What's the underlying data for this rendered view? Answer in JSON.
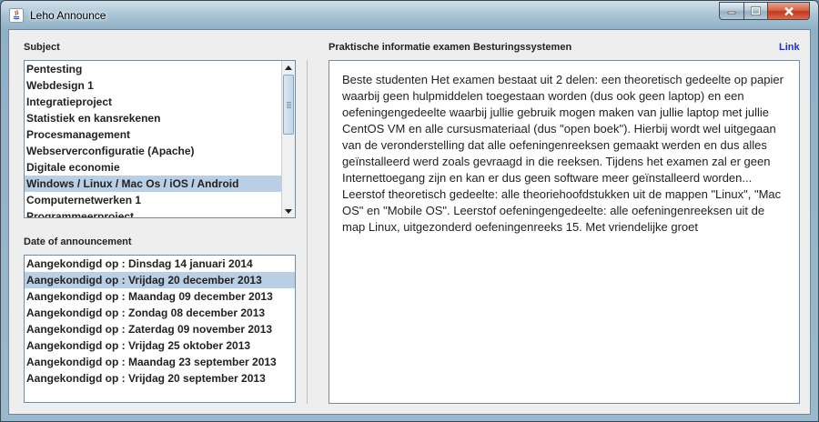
{
  "window": {
    "title": "Leho Announce",
    "controls": {
      "minimize": "minimize-icon",
      "maximize": "maximize-icon",
      "close": "close-icon"
    }
  },
  "subject": {
    "label": "Subject",
    "items": [
      "Pentesting",
      "Webdesign 1",
      "Integratieproject",
      "Statistiek en kansrekenen",
      "Procesmanagement",
      "Webserverconfiguratie (Apache)",
      "Digitale economie",
      "Windows / Linux / Mac Os / iOS / Android",
      "Computernetwerken 1",
      "Programmeerproject"
    ],
    "selected_index": 7
  },
  "announcements": {
    "label": "Date of announcement",
    "items": [
      "Aangekondigd op : Dinsdag 14 januari 2014",
      "Aangekondigd op : Vrijdag 20 december 2013",
      "Aangekondigd op : Maandag 09 december 2013",
      "Aangekondigd op : Zondag 08 december 2013",
      "Aangekondigd op : Zaterdag 09 november 2013",
      "Aangekondigd op : Vrijdag 25 oktober 2013",
      "Aangekondigd op : Maandag 23 september 2013",
      "Aangekondigd op : Vrijdag 20 september 2013"
    ],
    "selected_index": 1
  },
  "detail": {
    "title": "Praktische informatie examen Besturingssystemen",
    "link_label": "Link",
    "body": "Beste studenten Het examen bestaat uit 2 delen: een theoretisch gedeelte op papier waarbij geen hulpmiddelen toegestaan worden (dus ook geen laptop) en een oefeningengedeelte waarbij jullie gebruik mogen maken van jullie laptop met jullie CentOS VM en alle cursusmateriaal (dus \"open boek\"). Hierbij wordt wel uitgegaan van de veronderstelling dat alle oefeningenreeksen gemaakt werden en dus alles geïnstalleerd werd zoals gevraagd in die reeksen. Tijdens het examen zal er geen Internettoegang zijn en kan er dus geen software meer geïnstalleerd worden... Leerstof theoretisch gedeelte: alle theoriehoofdstukken uit de mappen \"Linux\", \"Mac OS\" en \"Mobile OS\". Leerstof oefeningengedeelte: alle oefeningenreeksen uit de map Linux, uitgezonderd oefeningenreeks 15. Met vriendelijke groet"
  },
  "colors": {
    "selection": "#b8cfe5",
    "link": "#1a2fd0"
  }
}
